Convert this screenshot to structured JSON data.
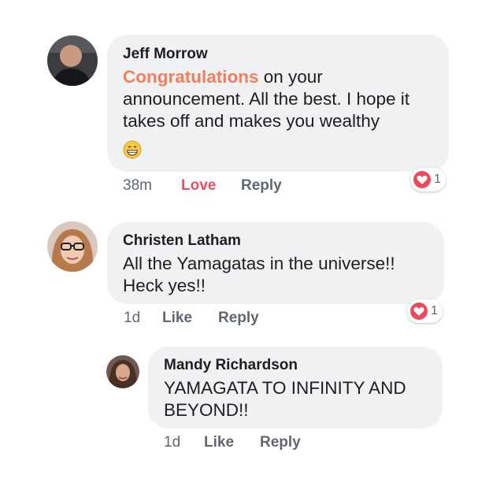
{
  "comments": [
    {
      "author": "Jeff Morrow",
      "text_highlight": "Congratulations",
      "text": " on your announcement. All the best. I hope it takes off and makes you wealthy",
      "emoji": "grinning-face-emoji",
      "time": "38m",
      "reaction_label": "Love",
      "reply_label": "Reply",
      "reaction_count": "1",
      "reaction_icon": "heart-icon"
    },
    {
      "author": "Christen Latham",
      "text": "All the Yamagatas in the universe!! Heck yes!!",
      "time": "1d",
      "reaction_label": "Like",
      "reply_label": "Reply",
      "reaction_count": "1",
      "reaction_icon": "heart-icon"
    },
    {
      "author": "Mandy Richardson",
      "text": "YAMAGATA TO INFINITY AND BEYOND!!",
      "time": "1d",
      "reaction_label": "Like",
      "reply_label": "Reply"
    }
  ],
  "colors": {
    "bubble": "#f0f1f3",
    "highlight": "#ef7e5c",
    "love": "#e55163",
    "heart": "#ea4a5b",
    "meta": "#606770"
  }
}
